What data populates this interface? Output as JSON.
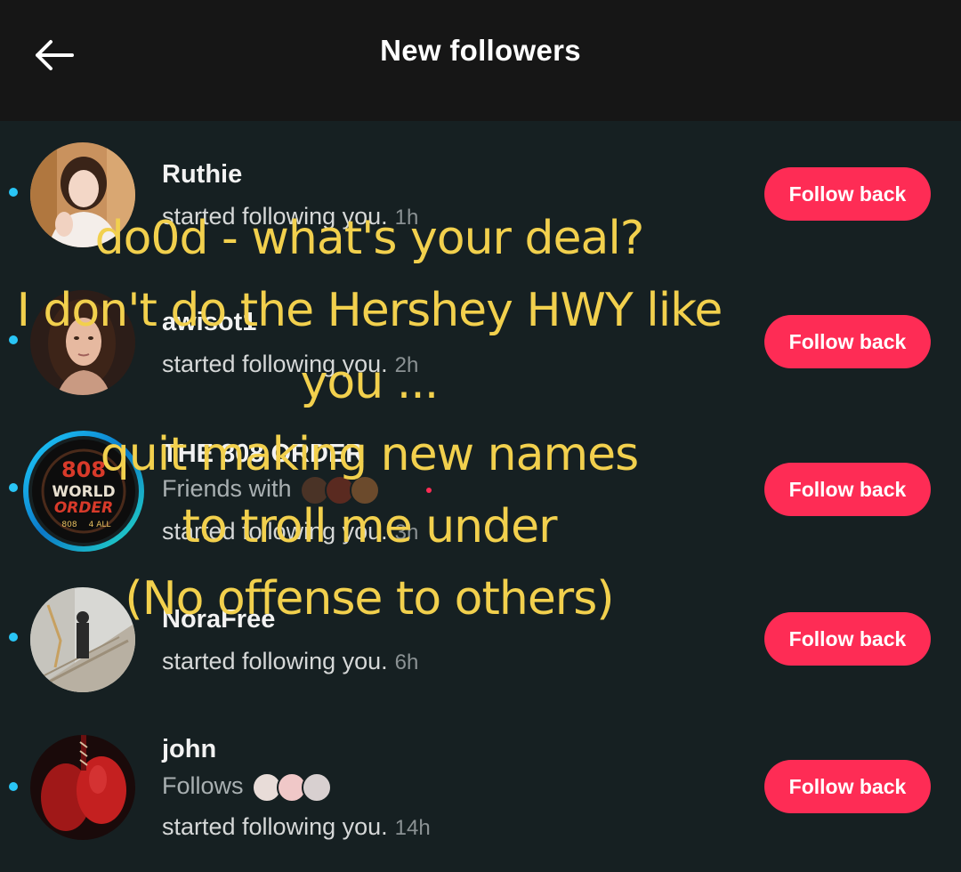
{
  "header": {
    "title": "New followers",
    "back_icon": "arrow-left-icon"
  },
  "followers": [
    {
      "name": "Ruthie",
      "context": "",
      "activity": "started following you.",
      "time": "1h",
      "button": "Follow back",
      "unread": true
    },
    {
      "name": "awisot1",
      "context": "",
      "activity": "started following you.",
      "time": "2h",
      "button": "Follow back",
      "unread": true
    },
    {
      "name": "THE 808 ORDER",
      "context": "Friends with",
      "activity": "started following you.",
      "time": "3h",
      "button": "Follow back",
      "unread": true,
      "avatar_text": [
        "808",
        "WORLD",
        "ORDER",
        "808",
        "4 ALL"
      ]
    },
    {
      "name": "NoraFree",
      "context": "",
      "activity": "started following you.",
      "time": "6h",
      "button": "Follow back",
      "unread": true
    },
    {
      "name": "john",
      "context": "Follows",
      "activity": "started following you.",
      "time": "14h",
      "button": "Follow back",
      "unread": true
    }
  ],
  "overlay_text": [
    "do0d - what's your deal?",
    "I don't do the Hershey HWY like",
    "you ...",
    "quit making new names",
    "to troll me under",
    "(No offense to others)"
  ],
  "colors": {
    "background": "#162022",
    "header": "#161616",
    "accent": "#fe2c55",
    "unread_dot": "#29c5f6",
    "overlay_text": "#f2d04d"
  }
}
